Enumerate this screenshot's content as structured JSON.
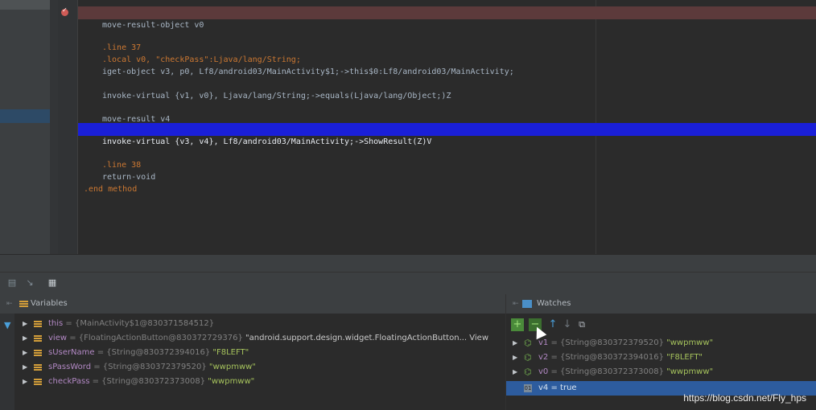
{
  "editor": {
    "lines": [
      {
        "text": "move-result-object v0",
        "kind": "breakpoint"
      },
      {
        "text": ".line 37",
        "kind": "directive"
      },
      {
        "text": ".local v0, \"checkPass\":Ljava/lang/String;",
        "kind": "local"
      },
      {
        "text": "iget-object v3, p0, Lf8/android03/MainActivity$1;->this$0:Lf8/android03/MainActivity;",
        "kind": "code"
      },
      {
        "text": "invoke-virtual {v1, v0}, Ljava/lang/String;->equals(Ljava/lang/Object;)Z",
        "kind": "code"
      },
      {
        "text": "move-result v4",
        "kind": "code"
      },
      {
        "text": "invoke-virtual {v3, v4}, Lf8/android03/MainActivity;->ShowResult(Z)V",
        "kind": "execution"
      },
      {
        "text": ".line 38",
        "kind": "directive"
      },
      {
        "text": "return-void",
        "kind": "code"
      },
      {
        "text": ".end method",
        "kind": "code"
      }
    ]
  },
  "variables": {
    "title": "Variables",
    "items": [
      {
        "name": "this",
        "type": "{MainActivity$1@830371584512}",
        "value": ""
      },
      {
        "name": "view",
        "type": "{FloatingActionButton@830372729376}",
        "value": "\"android.support.design.widget.FloatingActionButton... View"
      },
      {
        "name": "sUserName",
        "type": "{String@830372394016}",
        "value": "\"F8LEFT\""
      },
      {
        "name": "sPassWord",
        "type": "{String@830372379520}",
        "value": "\"wwpmww\""
      },
      {
        "name": "checkPass",
        "type": "{String@830372373008}",
        "value": "\"wwpmww\""
      }
    ]
  },
  "watches": {
    "title": "Watches",
    "items": [
      {
        "name": "v1",
        "type": "{String@830372379520}",
        "value": "\"wwpmww\""
      },
      {
        "name": "v2",
        "type": "{String@830372394016}",
        "value": "\"F8LEFT\""
      },
      {
        "name": "v0",
        "type": "{String@830372373008}",
        "value": "\"wwpmww\""
      },
      {
        "name": "v4",
        "type": "",
        "value": "true"
      }
    ]
  },
  "watermark": "https://blog.csdn.net/Fly_hps",
  "colors": {
    "execution_highlight": "#1a1fd8",
    "breakpoint_line": "#5c3a3b",
    "string_value": "#a5c25c",
    "selection": "#2d5c9e"
  }
}
